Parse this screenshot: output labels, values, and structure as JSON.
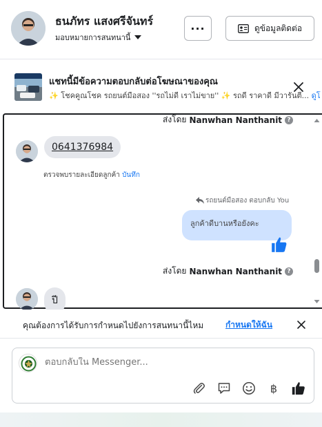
{
  "header": {
    "name": "ธนภัทร แสงศรีจันทร์",
    "assign_label": "มอบหมายการสนทนานี้",
    "more_label": "···",
    "contact_label": "ดูข้อมูลติดต่อ"
  },
  "banner": {
    "title": "แชทนี้มีข้อความตอบกลับต่อโฆษณาของคุณ",
    "subtitle": "✨ โชคคูณโชค รถยนต์มือสอง ''รถไม่ดี เราไม่ขาย'' ✨ รถดี ราคาดี มีวารันตี...",
    "link": "ดูโ"
  },
  "chat": {
    "sent_by_prefix": "ส่งโดย",
    "sender": "Nanwhan Nanthanit",
    "help_glyph": "?",
    "messages": {
      "phone": "0641376984",
      "note": "ตรวจพบรายละเอียดลูกค้า",
      "note_link": "บันทึก",
      "replied_label": "รถยนต์มือสอง ตอบกลับ You",
      "outgoing": "ลูกค้าดีบานหรือยังคะ",
      "last_incoming": "ปี"
    }
  },
  "prompt": {
    "text": "คุณต้องการได้รับการกำหนดไปยังการสนทนานี้ไหม",
    "link": "กำหนดให้ฉัน"
  },
  "composer": {
    "placeholder": "ตอบกลับใน Messenger...",
    "baht_glyph": "฿"
  },
  "colors": {
    "accent": "#1877f2",
    "outgoing_bubble": "#cfe2ff",
    "incoming_bubble": "#e4e6eb"
  },
  "icons": [
    "chevron-down-icon",
    "contact-card-icon",
    "close-icon",
    "reply-arrow-icon",
    "thumbs-up-icon",
    "paperclip-icon",
    "saved-reply-icon",
    "emoji-icon",
    "baht-icon"
  ]
}
